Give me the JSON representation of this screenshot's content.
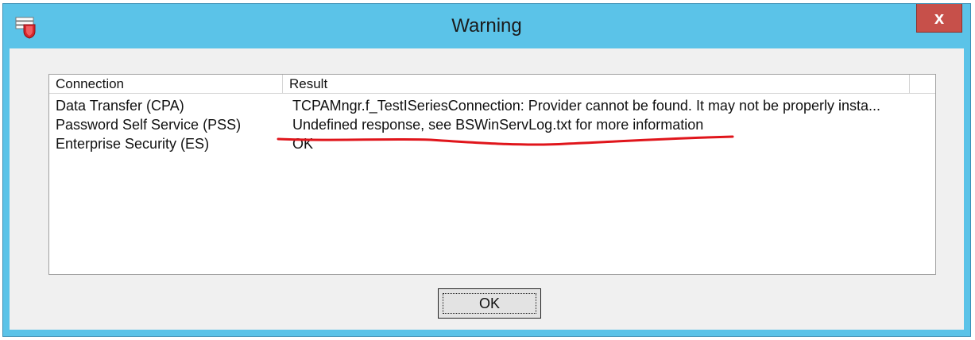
{
  "window": {
    "title": "Warning",
    "close_label": "x",
    "app_icon": "shield-app-icon"
  },
  "listview": {
    "columns": [
      "Connection",
      "Result"
    ],
    "rows": [
      {
        "connection": "Data Transfer (CPA)",
        "result": "TCPAMngr.f_TestISeriesConnection: Provider cannot be found. It may not be properly insta..."
      },
      {
        "connection": "Password Self Service (PSS)",
        "result": "Undefined response, see BSWinServLog.txt for more information"
      },
      {
        "connection": "Enterprise Security (ES)",
        "result": "OK"
      }
    ]
  },
  "annotation": {
    "color": "#e0151b"
  },
  "buttons": {
    "ok_label": "OK"
  },
  "colors": {
    "titlebar": "#5bc3e8",
    "close_button": "#c7504a"
  }
}
